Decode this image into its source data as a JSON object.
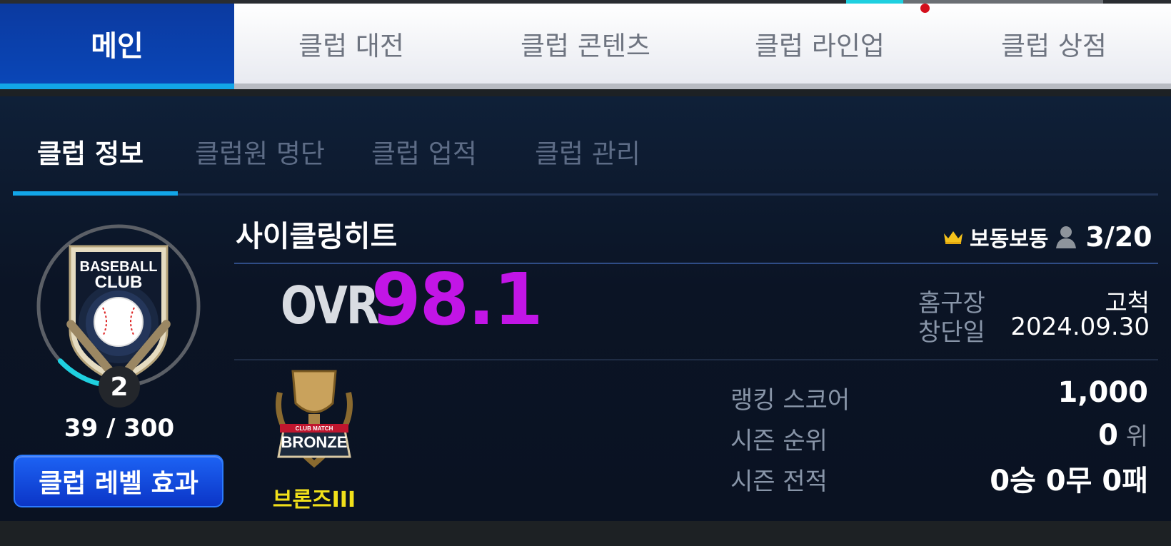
{
  "main_tabs": [
    {
      "label": "메인",
      "active": true
    },
    {
      "label": "클럽 대전",
      "active": false
    },
    {
      "label": "클럽 콘텐츠",
      "active": false
    },
    {
      "label": "클럽 라인업",
      "active": false,
      "notification": true
    },
    {
      "label": "클럽 상점",
      "active": false
    }
  ],
  "sub_tabs": [
    {
      "label": "클럽 정보",
      "active": true
    },
    {
      "label": "클럽원 명단",
      "active": false
    },
    {
      "label": "클럽 업적",
      "active": false
    },
    {
      "label": "클럽 관리",
      "active": false
    }
  ],
  "club": {
    "name": "사이클링히트",
    "emblem_text_1": "BASEBALL",
    "emblem_text_2": "CLUB",
    "level": "2",
    "exp": "39 / 300",
    "exp_progress": 0.13,
    "level_button": "클럽 레벨 효과",
    "owner": "보동보동",
    "members": "3/20",
    "ovr_label": "OVR",
    "ovr_value": "98.1",
    "home_stadium_label": "홈구장",
    "home_stadium_value": "고척",
    "founded_label": "창단일",
    "founded_value": "2024.09.30",
    "tier_badge_text": "BRONZE",
    "tier_badge_sub": "CLUB MATCH",
    "tier_name": "브론즈III",
    "ranking_score_label": "랭킹 스코어",
    "ranking_score_value": "1,000",
    "season_rank_label": "시즌 순위",
    "season_rank_value": "0",
    "season_rank_unit": "위",
    "season_record_label": "시즌 전적",
    "season_record_value": "0승 0무 0패"
  },
  "colors": {
    "accent_blue": "#0b3aa0",
    "tab_underline": "#12a6e8",
    "ovr": "#c215e6",
    "tier": "#f1e01a",
    "exp_ring": "#1fd0e0"
  },
  "icons": [
    "crown-icon",
    "member-icon",
    "club-emblem",
    "bronze-trophy-icon"
  ]
}
